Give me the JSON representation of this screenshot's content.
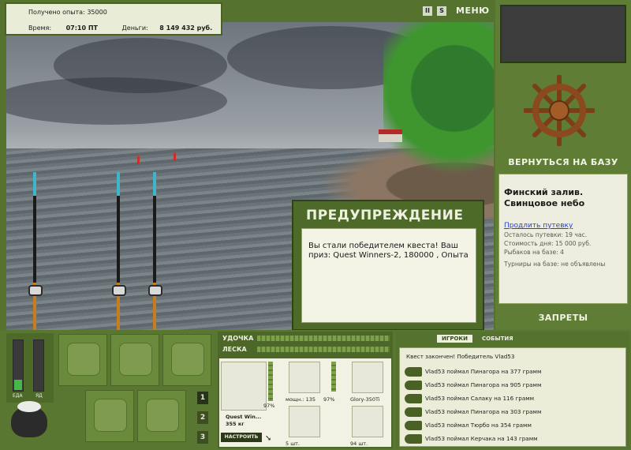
{
  "header": {
    "experience_label": "Получено опыта:",
    "experience_value": "35000",
    "time_label": "Время:",
    "time_value": "07:10 ПТ",
    "money_label": "Деньги:",
    "money_value": "8 149 432 руб."
  },
  "top_buttons": {
    "pause_glyph": "II",
    "s_glyph": "S",
    "menu_label": "МЕНЮ"
  },
  "right_panel": {
    "return_label": "ВЕРНУТЬСЯ НА БАЗУ",
    "location_title": "Финский залив.",
    "location_subtitle": "Свинцовое небо",
    "extend_link": "Продлить путевку",
    "remaining": "Осталось путевки: 19 час.",
    "day_cost": "Стоимость дня: 15 000 руб.",
    "fishers": "Рыбаков на базе: 4",
    "tournaments": "Турниры на базе: не объявлены",
    "bans_label": "ЗАПРЕТЫ"
  },
  "warning": {
    "title": "ПРЕДУПРЕЖДЕНИЕ",
    "message": "Вы стали победителем квеста! Ваш приз: Quest Winners-2, 180000 , Опыта"
  },
  "gauges": {
    "food_label": "ЕДА",
    "poison_label": "ЯД",
    "food_level": 0.2,
    "poison_level": 0.0
  },
  "hotbar": {
    "slots": [
      "1",
      "2",
      "3"
    ],
    "active": "1"
  },
  "tackle": {
    "rod_label": "УДОЧКА",
    "line_label": "ЛЕСКА",
    "rod_name": "Quest Win...",
    "rod_weight": "355 кг",
    "rod_percent": "97%",
    "reel_info": "мощн.: 135",
    "reel_percent": "97%",
    "lure_name": "Glory-350Ti",
    "hook_count": "5 шт.",
    "bait_count": "94 шт.",
    "setup_label": "НАСТРОИТЬ"
  },
  "log": {
    "tabs": [
      "ИГРОКИ",
      "СОБЫТИЯ"
    ],
    "active_tab": "ИГРОКИ",
    "lines": [
      "Квест закончен! Победитель Vlad53",
      "Vlad53 поймал Пинагора на 377 грамм",
      "Vlad53 поймал Пинагора на 905 грамм",
      "Vlad53 поймал Салаку на 116 грамм",
      "Vlad53 поймал Пинагора на 303 грамм",
      "Vlad53 поймал Тюрбо на 354 грамм",
      "Vlad53 поймал Керчака на 143 грамм"
    ]
  }
}
